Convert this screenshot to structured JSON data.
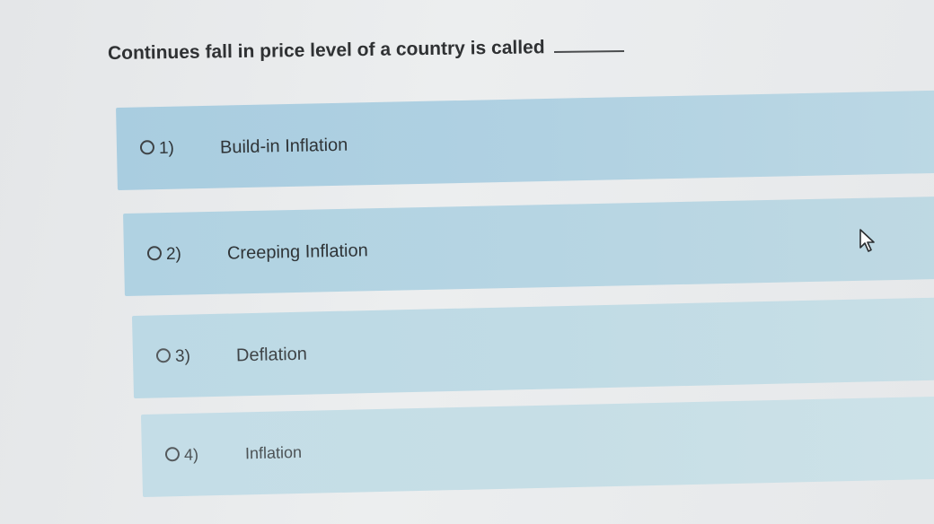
{
  "question": {
    "text": "Continues fall in price level of a country is called"
  },
  "options": [
    {
      "number": "1)",
      "label": "Build-in Inflation"
    },
    {
      "number": "2)",
      "label": "Creeping Inflation"
    },
    {
      "number": "3)",
      "label": "Deflation"
    },
    {
      "number": "4)",
      "label": "Inflation"
    }
  ],
  "icons": {
    "cursor": "mouse-pointer-icon",
    "radio": "radio-unchecked-icon"
  },
  "colors": {
    "option_bg": "#b0d2e2",
    "text": "#2f3133"
  }
}
